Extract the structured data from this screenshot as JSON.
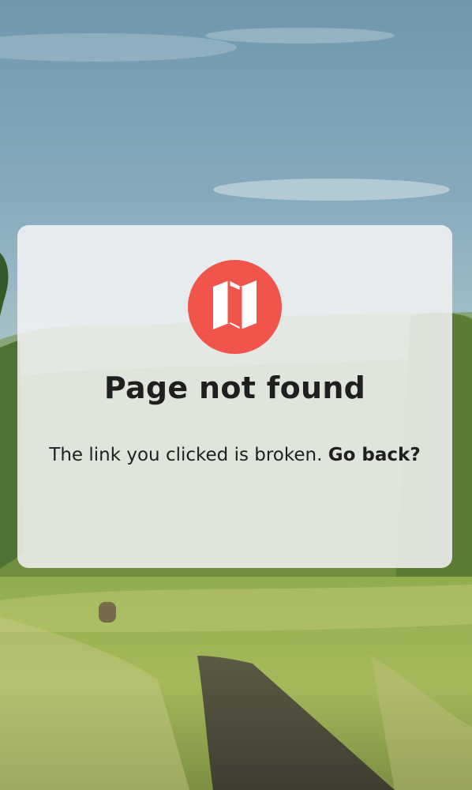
{
  "error_card": {
    "logo_icon": "folded-map-icon",
    "title": "Page not found",
    "message": "The link you clicked is broken.",
    "link_label": "Go back?"
  },
  "colors": {
    "logo_background": "#f0544a",
    "text": "#1f1f1f",
    "card_background": "#f2f3f5"
  }
}
